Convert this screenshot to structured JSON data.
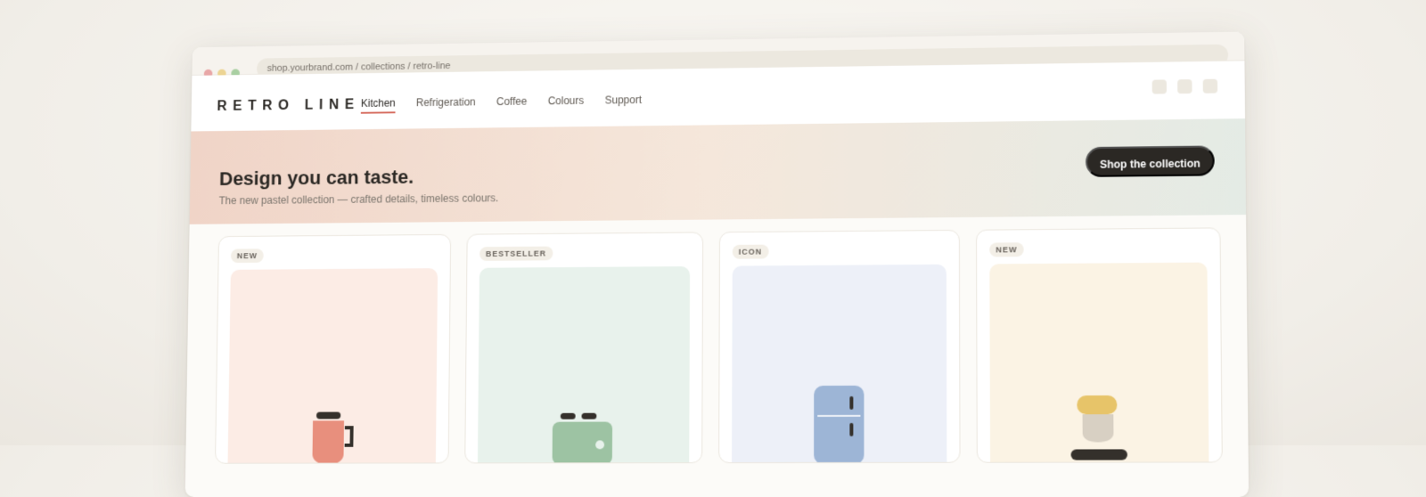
{
  "browser": {
    "url": "shop.yourbrand.com / collections / retro-line"
  },
  "navigation": {
    "logo": "RETRO LINE",
    "items": [
      "Kitchen",
      "Refrigeration",
      "Coffee",
      "Colours",
      "Support"
    ],
    "active_item": "Kitchen"
  },
  "hero": {
    "title": "Design you can taste.",
    "subtitle": "The new pastel collection — crafted details, timeless colours.",
    "cta_label": "Shop the collection"
  },
  "products": [
    {
      "badge": "NEW",
      "icon": "kettle-icon",
      "background_color": "#fcece5",
      "product_color": "#e88f7d"
    },
    {
      "badge": "BESTSELLER",
      "icon": "toaster-icon",
      "background_color": "#e8f2ec",
      "product_color": "#9dc3a3"
    },
    {
      "badge": "ICON",
      "icon": "refrigerator-icon",
      "background_color": "#edf0f8",
      "product_color": "#9db5d6"
    },
    {
      "badge": "NEW",
      "icon": "coffee-machine-icon",
      "background_color": "#fbf3e4",
      "product_color": "#e7c469"
    }
  ],
  "colors": {
    "active_underline": "#d66c5f",
    "button_background": "#2b2824",
    "hero_gradient_start": "#f0d4c7",
    "hero_gradient_end": "#e4ebe5"
  }
}
